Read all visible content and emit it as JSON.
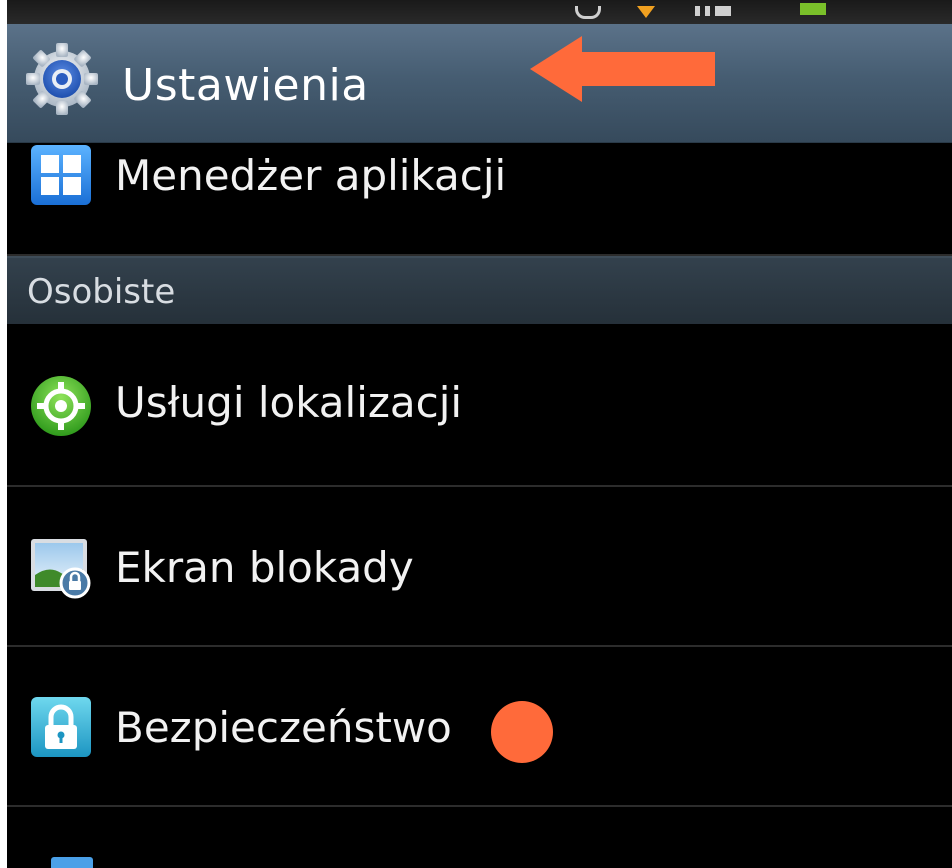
{
  "app": {
    "title": "Ustawienia"
  },
  "items": [
    {
      "label": "Menedżer aplikacji",
      "icon": "app-manager-icon"
    },
    {
      "label": "Usługi lokalizacji",
      "icon": "location-icon"
    },
    {
      "label": "Ekran blokady",
      "icon": "lock-screen-icon"
    },
    {
      "label": "Bezpieczeństwo",
      "icon": "security-lock-icon"
    }
  ],
  "sections": {
    "personal": "Osobiste"
  },
  "colors": {
    "annotation": "#ff6a3a",
    "titlebar": "#465d72",
    "background": "#000000",
    "text": "#f2f2f2"
  }
}
